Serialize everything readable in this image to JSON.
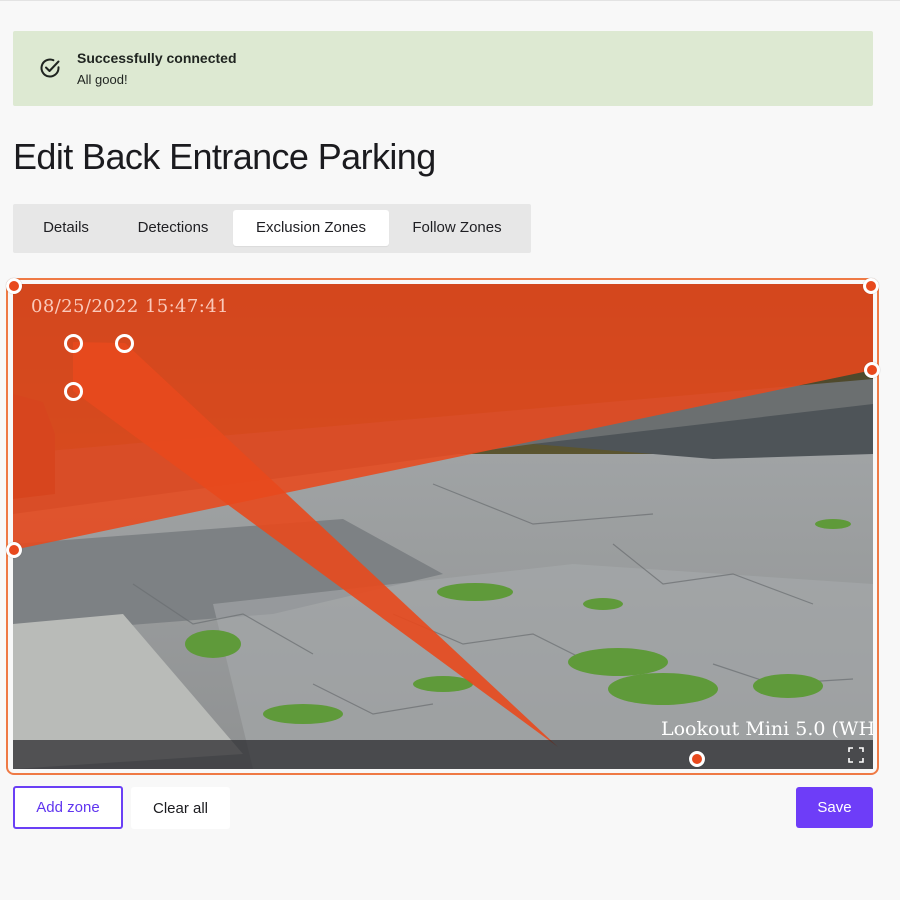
{
  "alert": {
    "title": "Successfully connected",
    "message": "All good!",
    "icon": "check-circle-icon",
    "background_color": "#dde9d2"
  },
  "page": {
    "title": "Edit Back Entrance Parking"
  },
  "tabs": [
    {
      "label": "Details",
      "active": false
    },
    {
      "label": "Detections",
      "active": false
    },
    {
      "label": "Exclusion Zones",
      "active": true
    },
    {
      "label": "Follow Zones",
      "active": false
    }
  ],
  "camera": {
    "timestamp": "08/25/2022 15:47:41",
    "label": "Lookout Mini 5.0 (WH",
    "zone_color": "#e8491d",
    "fullscreen_icon": "fullscreen-icon"
  },
  "actions": {
    "add_zone": "Add zone",
    "clear_all": "Clear all",
    "save": "Save"
  },
  "colors": {
    "accent": "#6e3df8",
    "frame": "#ef7a45"
  }
}
